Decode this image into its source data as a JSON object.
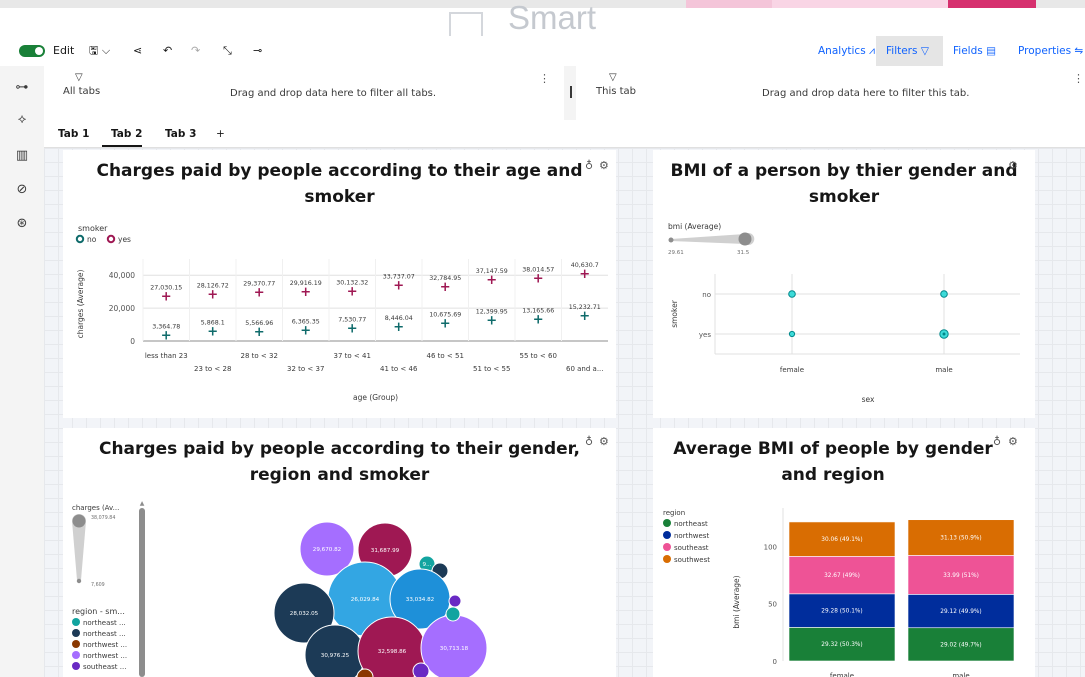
{
  "app": {
    "brand_word": "Smart"
  },
  "toolbar": {
    "edit_label": "Edit",
    "save_icon": "save-icon",
    "analytics_label": "Analytics",
    "filters_label": "Filters",
    "fields_label": "Fields",
    "properties_label": "Properties",
    "toggle_on": true
  },
  "filters": {
    "all_tabs_title": "All tabs",
    "all_tabs_drop": "Drag and drop data here to filter all tabs.",
    "this_tab_title": "This tab",
    "this_tab_drop": "Drag and drop data here to filter this tab."
  },
  "tabs": [
    {
      "label": "Tab 1"
    },
    {
      "label": "Tab 2",
      "active": true
    },
    {
      "label": "Tab 3"
    },
    {
      "label": "+"
    }
  ],
  "colors": {
    "accent": "#0f62fe",
    "no": "#0f6b6b",
    "yes": "#9f1853",
    "northeast": "#198038",
    "northwest": "#002d9c",
    "southeast": "#ee5396",
    "southwest": "#d96d02"
  },
  "cards": {
    "c1_title_1": "Charges paid by people according to their age and",
    "c1_title_2": "smoker",
    "c2_title_1": "BMI of a person by thier gender and",
    "c2_title_2": "smoker",
    "c3_title_1": "Charges paid by people according to their gender,",
    "c3_title_2": "region and smoker",
    "c4_title_1": "Average BMI of people by gender",
    "c4_title_2": "and region"
  },
  "chart_data": [
    {
      "type": "scatter",
      "legend_title": "smoker",
      "legend": [
        "no",
        "yes"
      ],
      "xlabel": "age (Group)",
      "ylabel": "charges (Average)",
      "ylim": [
        0,
        45000
      ],
      "yticks": [
        "0",
        "20,000",
        "40,000"
      ],
      "categories": [
        "less than 23",
        "23 to < 28",
        "28 to < 32",
        "32 to < 37",
        "37 to < 41",
        "41 to < 46",
        "46 to < 51",
        "51 to < 55",
        "55 to < 60",
        "60 and a..."
      ],
      "series": [
        {
          "name": "yes",
          "values": [
            27030.15,
            28126.72,
            29370.77,
            29916.19,
            30132.32,
            33737.07,
            32784.95,
            37147.59,
            38014.57,
            40630.7
          ],
          "labels": [
            "27,030.15",
            "28,126.72",
            "29,370.77",
            "29,916.19",
            "30,132.32",
            "33,737.07",
            "32,784.95",
            "37,147.59",
            "38,014.57",
            "40,630.7"
          ]
        },
        {
          "name": "no",
          "values": [
            3364.78,
            5868.1,
            5566.96,
            6365.35,
            7530.77,
            8446.04,
            10675.69,
            12399.95,
            13165.66,
            15232.71
          ],
          "labels": [
            "3,364.78",
            "5,868.1",
            "5,566.96",
            "6,365.35",
            "7,530.77",
            "8,446.04",
            "10,675.69",
            "12,399.95",
            "13,165.66",
            "15,232.71"
          ]
        }
      ]
    },
    {
      "type": "scatter",
      "size_legend_title": "bmi (Average)",
      "size_min": "29.61",
      "size_max": "31.5",
      "xlabel": "sex",
      "ylabel": "smoker",
      "x_categories": [
        "female",
        "male"
      ],
      "y_categories": [
        "no",
        "yes"
      ]
    },
    {
      "type": "bubble",
      "size_legend_title": "charges (Av...",
      "size_max": "38,079.84",
      "size_min": "7,609",
      "color_legend_title": "region - sm...",
      "color_legend": [
        {
          "label": "northeast ...",
          "color": "#12a4a0"
        },
        {
          "label": "northeast ...",
          "color": "#1c3a56"
        },
        {
          "label": "northwest ...",
          "color": "#8a3800"
        },
        {
          "label": "northwest ...",
          "color": "#a56eff"
        },
        {
          "label": "southeast ...",
          "color": "#6929c4"
        }
      ],
      "bubble_labels": [
        "29,670.82",
        "31,687.99",
        "9...",
        "26,029.84",
        "33,034.82",
        "28,032.05",
        "30,976.25",
        "32,598.86",
        "30,713.18"
      ]
    },
    {
      "type": "bar",
      "stacked": true,
      "legend_title": "region",
      "categories": [
        "female",
        "male"
      ],
      "ylabel": "bmi (Average)",
      "yticks": [
        "0",
        "50",
        "100"
      ],
      "ylim": [
        0,
        130
      ],
      "series": [
        {
          "name": "northeast",
          "values": [
            29.32,
            29.02
          ],
          "labels": [
            "29.32 (50.3%)",
            "29.02 (49.7%)"
          ]
        },
        {
          "name": "northwest",
          "values": [
            29.28,
            29.12
          ],
          "labels": [
            "29.28 (50.1%)",
            "29.12 (49.9%)"
          ]
        },
        {
          "name": "southeast",
          "values": [
            32.67,
            33.99
          ],
          "labels": [
            "32.67 (49%)",
            "33.99 (51%)"
          ]
        },
        {
          "name": "southwest",
          "values": [
            30.06,
            31.13
          ],
          "labels": [
            "30.06 (49.1%)",
            "31.13 (50.9%)"
          ]
        }
      ]
    }
  ]
}
